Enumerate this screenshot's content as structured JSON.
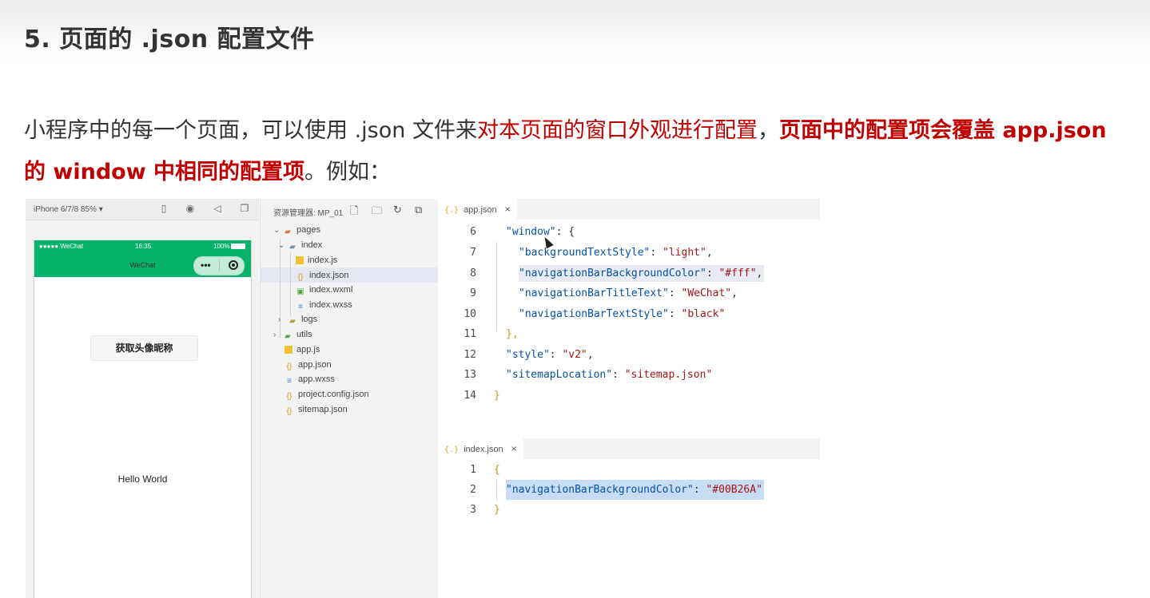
{
  "heading": "5. 页面的 .json 配置文件",
  "paragraph": {
    "part1": "小程序中的每一个页面，可以使用 .json 文件来",
    "part2_red": "对本页面的窗口外观进行配置",
    "part3": "，",
    "part4_bold_red": "页面中的配置项会覆盖 app.json 的 window 中相同的配置项",
    "part5": "。例如："
  },
  "simulator": {
    "device": "iPhone 6/7/8 85% ▾",
    "status_left": "●●●●● WeChat",
    "status_time": "16:35",
    "status_battery": "100%",
    "nav_title": "WeChat",
    "capsule_dots": "•••",
    "get_button": "获取头像昵称",
    "hello": "Hello World",
    "accent_color": "#07b26a"
  },
  "explorer": {
    "title": "资源管理器: MP_01",
    "items": [
      {
        "label": "pages",
        "icon": "folder-icon"
      },
      {
        "label": "index",
        "icon": "folder-icon"
      },
      {
        "label": "index.js",
        "icon": "js-file-icon"
      },
      {
        "label": "index.json",
        "icon": "json-file-icon"
      },
      {
        "label": "index.wxml",
        "icon": "wxml-file-icon"
      },
      {
        "label": "index.wxss",
        "icon": "wxss-file-icon"
      },
      {
        "label": "logs",
        "icon": "folder-icon"
      },
      {
        "label": "utils",
        "icon": "folder-icon"
      },
      {
        "label": "app.js",
        "icon": "js-file-icon"
      },
      {
        "label": "app.json",
        "icon": "json-file-icon"
      },
      {
        "label": "app.wxss",
        "icon": "wxss-file-icon"
      },
      {
        "label": "project.config.json",
        "icon": "json-file-icon"
      },
      {
        "label": "sitemap.json",
        "icon": "json-file-icon"
      }
    ],
    "selected": "index.json"
  },
  "editor_app": {
    "tab": "app.json",
    "tab_icon": "{.}",
    "close": "×",
    "lines": [
      {
        "n": "6",
        "key": "\"window\"",
        "rest": ": {"
      },
      {
        "n": "7",
        "key": "\"backgroundTextStyle\"",
        "rest": ": ",
        "val": "\"light\"",
        "end": ","
      },
      {
        "n": "8",
        "key": "\"navigationBarBackgroundColor\"",
        "rest": ": ",
        "val": "\"#fff\"",
        "end": ","
      },
      {
        "n": "9",
        "key": "\"navigationBarTitleText\"",
        "rest": ": ",
        "val": "\"WeChat\"",
        "end": ","
      },
      {
        "n": "10",
        "key": "\"navigationBarTextStyle\"",
        "rest": ": ",
        "val": "\"black\"",
        "end": ""
      },
      {
        "n": "11",
        "key": "",
        "rest": "},",
        "val": "",
        "end": ""
      },
      {
        "n": "12",
        "key": "\"style\"",
        "rest": ": ",
        "val": "\"v2\"",
        "end": ","
      },
      {
        "n": "13",
        "key": "\"sitemapLocation\"",
        "rest": ": ",
        "val": "\"sitemap.json\"",
        "end": ""
      },
      {
        "n": "14",
        "key": "",
        "rest": "}",
        "val": "",
        "end": ""
      }
    ]
  },
  "editor_index": {
    "tab": "index.json",
    "tab_icon": "{.}",
    "close": "×",
    "lines": [
      {
        "n": "1",
        "text": "{"
      },
      {
        "n": "2",
        "key": "\"navigationBarBackgroundColor\"",
        "rest": ": ",
        "val": "\"#00B26A\""
      },
      {
        "n": "3",
        "text": "}"
      }
    ]
  }
}
